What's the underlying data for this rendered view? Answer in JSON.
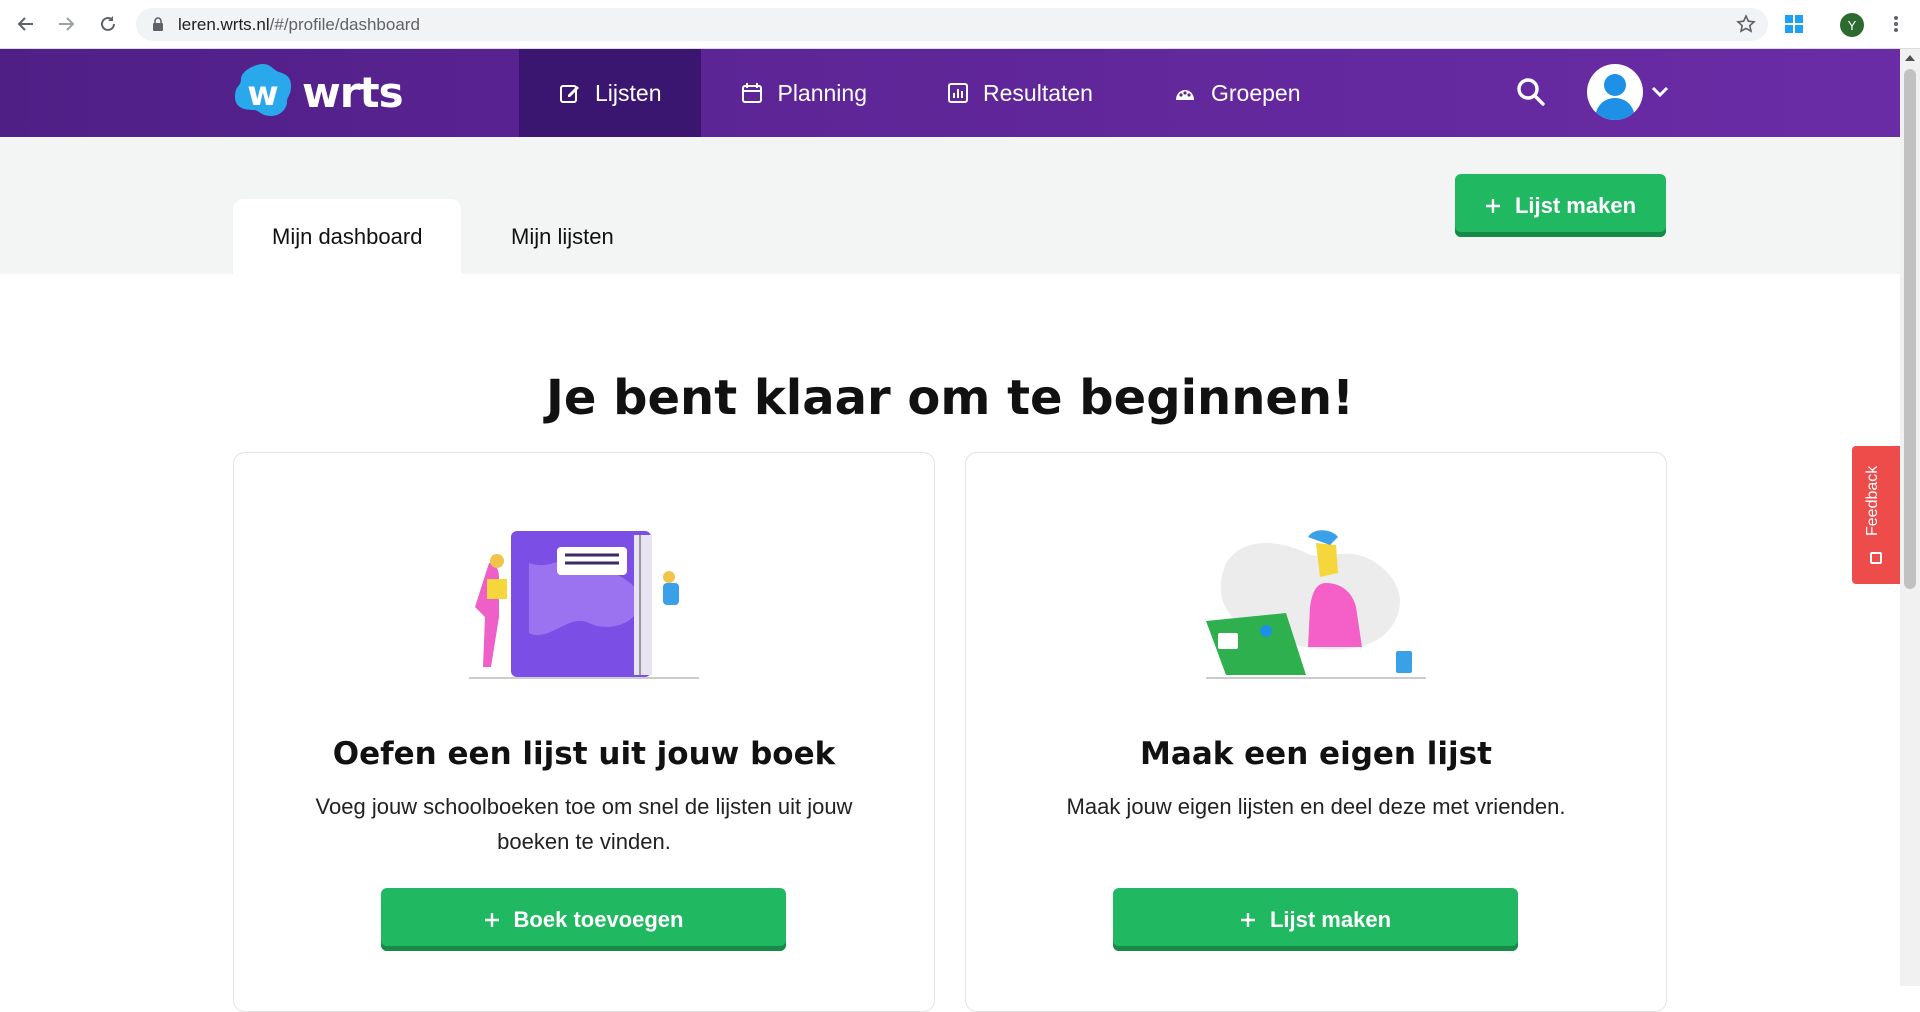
{
  "browser": {
    "url_host": "leren.wrts.nl",
    "url_path": "/#/profile/dashboard",
    "profile_initial": "Y"
  },
  "header": {
    "logo_text": "wrts",
    "nav": [
      {
        "label": "Lijsten",
        "icon": "edit-icon",
        "active": true
      },
      {
        "label": "Planning",
        "icon": "calendar-icon",
        "active": false
      },
      {
        "label": "Resultaten",
        "icon": "chart-icon",
        "active": false
      },
      {
        "label": "Groepen",
        "icon": "group-icon",
        "active": false
      }
    ]
  },
  "tabs": [
    {
      "label": "Mijn dashboard",
      "active": true
    },
    {
      "label": "Mijn lijsten",
      "active": false
    }
  ],
  "top_button": {
    "label": "Lijst maken",
    "icon": "plus-icon"
  },
  "headline": "Je bent klaar om te beginnen!",
  "cards": [
    {
      "title": "Oefen een lijst uit jouw boek",
      "text": "Voeg jouw schoolboeken toe om snel de lijsten uit jouw boeken te vinden.",
      "button": "Boek toevoegen"
    },
    {
      "title": "Maak een eigen lijst",
      "text": "Maak jouw eigen lijsten en deel deze met vrienden.",
      "button": "Lijst maken"
    }
  ],
  "feedback": {
    "label": "Feedback"
  },
  "colors": {
    "brand_purple": "#5d2596",
    "nav_active": "#3a1670",
    "green": "#21b862",
    "feedback_red": "#ee4b4b"
  }
}
